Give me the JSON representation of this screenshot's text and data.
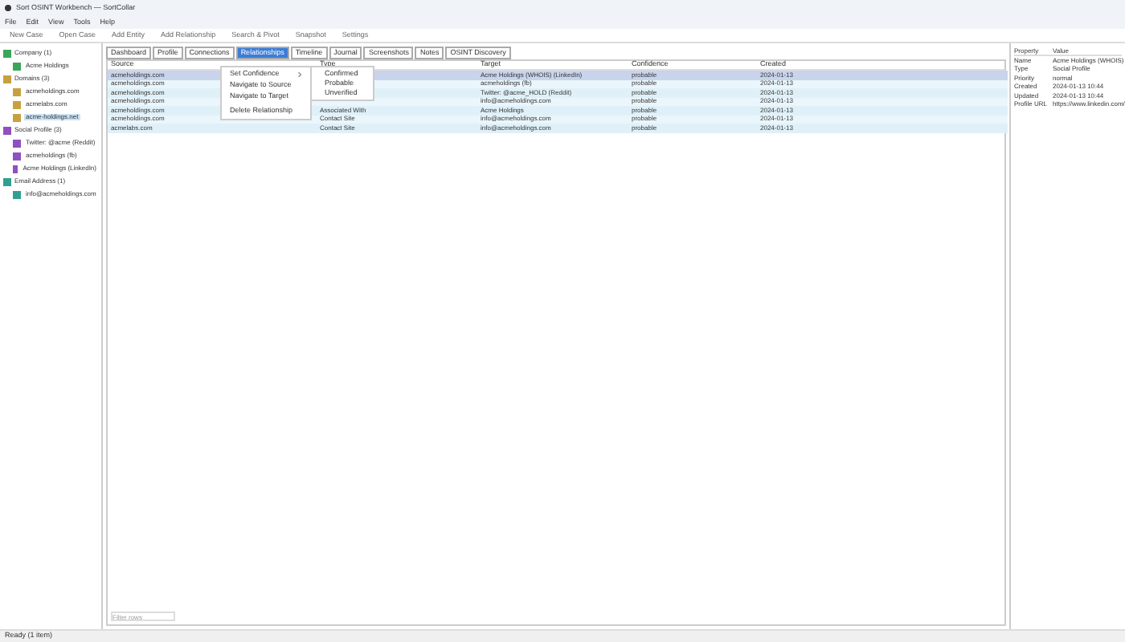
{
  "window": {
    "title": "Sort OSINT Workbench — SortCollar"
  },
  "menu": [
    "File",
    "Edit",
    "View",
    "Tools",
    "Help"
  ],
  "toolbar": [
    "New Case",
    "Open Case",
    "Add Entity",
    "Add Relationship",
    "Search & Pivot",
    "Snapshot",
    "Settings"
  ],
  "tree": [
    {
      "label": "Company (1)",
      "color": "#3aa65a",
      "children": [
        {
          "label": "Acme Holdings",
          "selected": false
        }
      ]
    },
    {
      "label": "Domains (3)",
      "color": "#c8a040",
      "children": [
        {
          "label": "acmeholdings.com",
          "selected": false
        },
        {
          "label": "acmelabs.com",
          "selected": false
        },
        {
          "label": "acme-holdings.net",
          "selected": true
        }
      ]
    },
    {
      "label": "Social Profile (3)",
      "color": "#9050c0",
      "children": [
        {
          "label": "Twitter: @acme (Reddit)",
          "selected": false
        },
        {
          "label": "acmeholdings (fb)",
          "selected": false
        },
        {
          "label": "Acme Holdings (LinkedIn)",
          "selected": false
        }
      ]
    },
    {
      "label": "Email Address (1)",
      "color": "#30a090",
      "children": [
        {
          "label": "info@acmeholdings.com",
          "selected": false
        }
      ]
    }
  ],
  "tabs": [
    {
      "label": "Dashboard",
      "selected": false
    },
    {
      "label": "Profile",
      "selected": false
    },
    {
      "label": "Connections",
      "selected": false
    },
    {
      "label": "Relationships",
      "selected": true
    },
    {
      "label": "Timeline",
      "selected": false
    },
    {
      "label": "Journal",
      "selected": false
    },
    {
      "label": "Screenshots",
      "selected": false
    },
    {
      "label": "Notes",
      "selected": false
    },
    {
      "label": "OSINT Discovery",
      "selected": false
    }
  ],
  "table": {
    "columns": [
      "Source",
      "Type",
      "Target",
      "Confidence",
      "Created"
    ],
    "rows": [
      {
        "cells": [
          "acmeholdings.com",
          null,
          "Acme Holdings (WHOIS) (LinkedIn)",
          "probable",
          "2024-01-13"
        ],
        "selected": true
      },
      {
        "cells": [
          "acmeholdings.com",
          null,
          "acmeholdings (fb)",
          "probable",
          "2024-01-13"
        ],
        "selected": false
      },
      {
        "cells": [
          "acmeholdings.com",
          null,
          "Twitter: @acme_HOLD (Reddit)",
          "probable",
          "2024-01-13"
        ],
        "selected": false
      },
      {
        "cells": [
          "acmeholdings.com",
          null,
          "info@acmeholdings.com",
          "probable",
          "2024-01-13"
        ],
        "selected": false
      },
      {
        "cells": [
          "acmeholdings.com",
          "Associated With",
          "Acme Holdings",
          "probable",
          "2024-01-13"
        ],
        "selected": false
      },
      {
        "cells": [
          "acmeholdings.com",
          "Contact Site",
          "info@acmeholdings.com",
          "probable",
          "2024-01-13"
        ],
        "selected": false
      },
      {
        "cells": [
          "acmelabs.com",
          "Contact Site",
          "info@acmeholdings.com",
          "probable",
          "2024-01-13"
        ],
        "selected": false
      }
    ]
  },
  "context_menu": {
    "items": [
      {
        "label": "Set Confidence",
        "submenu": true
      },
      {
        "label": "Navigate to Source",
        "submenu": false
      },
      {
        "label": "Navigate to Target",
        "submenu": false
      },
      {
        "label": "Delete Relationship",
        "submenu": false
      }
    ],
    "submenu": [
      "Confirmed",
      "Probable",
      "Unverified"
    ]
  },
  "filter": {
    "placeholder": "Filter rows"
  },
  "properties": {
    "columns": [
      "Property",
      "Value"
    ],
    "rows": [
      [
        "Name",
        "Acme Holdings (WHOIS)"
      ],
      [
        "Type",
        "Social Profile"
      ],
      [
        "Priority",
        "normal"
      ],
      [
        "Created",
        "2024-01-13 10:44"
      ],
      [
        "Updated",
        "2024-01-13 10:44"
      ],
      [
        "Profile URL",
        "https://www.linkedin.com/"
      ]
    ]
  },
  "status_bar": "Ready (1 item)"
}
